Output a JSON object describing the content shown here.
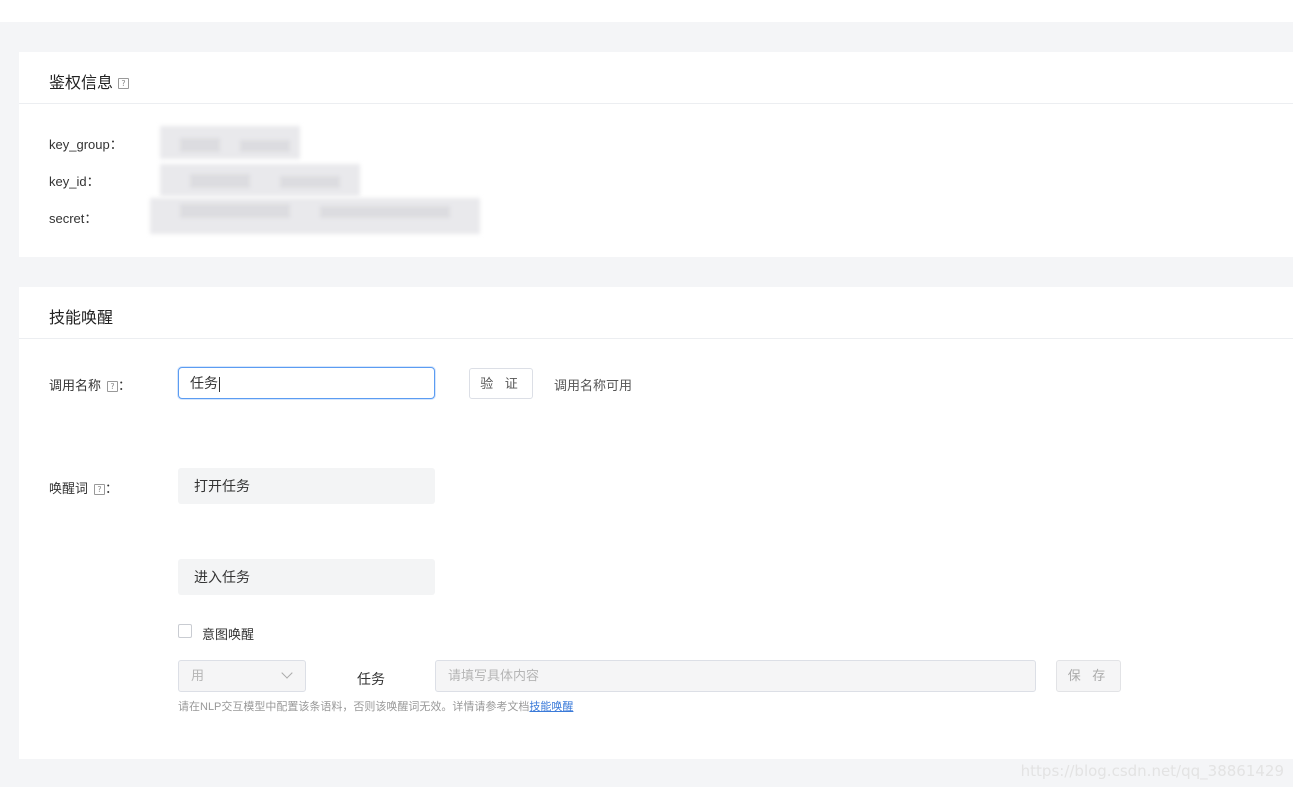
{
  "auth": {
    "title": "鉴权信息",
    "help_glyph": "?",
    "fields": [
      {
        "label": "key_group："
      },
      {
        "label": "key_id："
      },
      {
        "label": "secret："
      }
    ]
  },
  "skill": {
    "title": "技能唤醒",
    "call_name": {
      "label": "调用名称",
      "colon": "：",
      "value": "任务",
      "verify_button": "验 证",
      "status": "调用名称可用"
    },
    "wake_words": {
      "label": "唤醒词",
      "colon": "：",
      "items": [
        "打开任务",
        "进入任务"
      ]
    },
    "intent_wake": {
      "checkbox_label": "意图唤醒",
      "checked": false,
      "select_value": "用",
      "middle_text": "任务",
      "content_placeholder": "请填写具体内容",
      "save_button": "保 存",
      "hint_text": "请在NLP交互模型中配置该条语料，否则该唤醒词无效。详情请参考文档",
      "hint_link": "技能唤醒"
    }
  },
  "watermark": "https://blog.csdn.net/qq_38861429"
}
